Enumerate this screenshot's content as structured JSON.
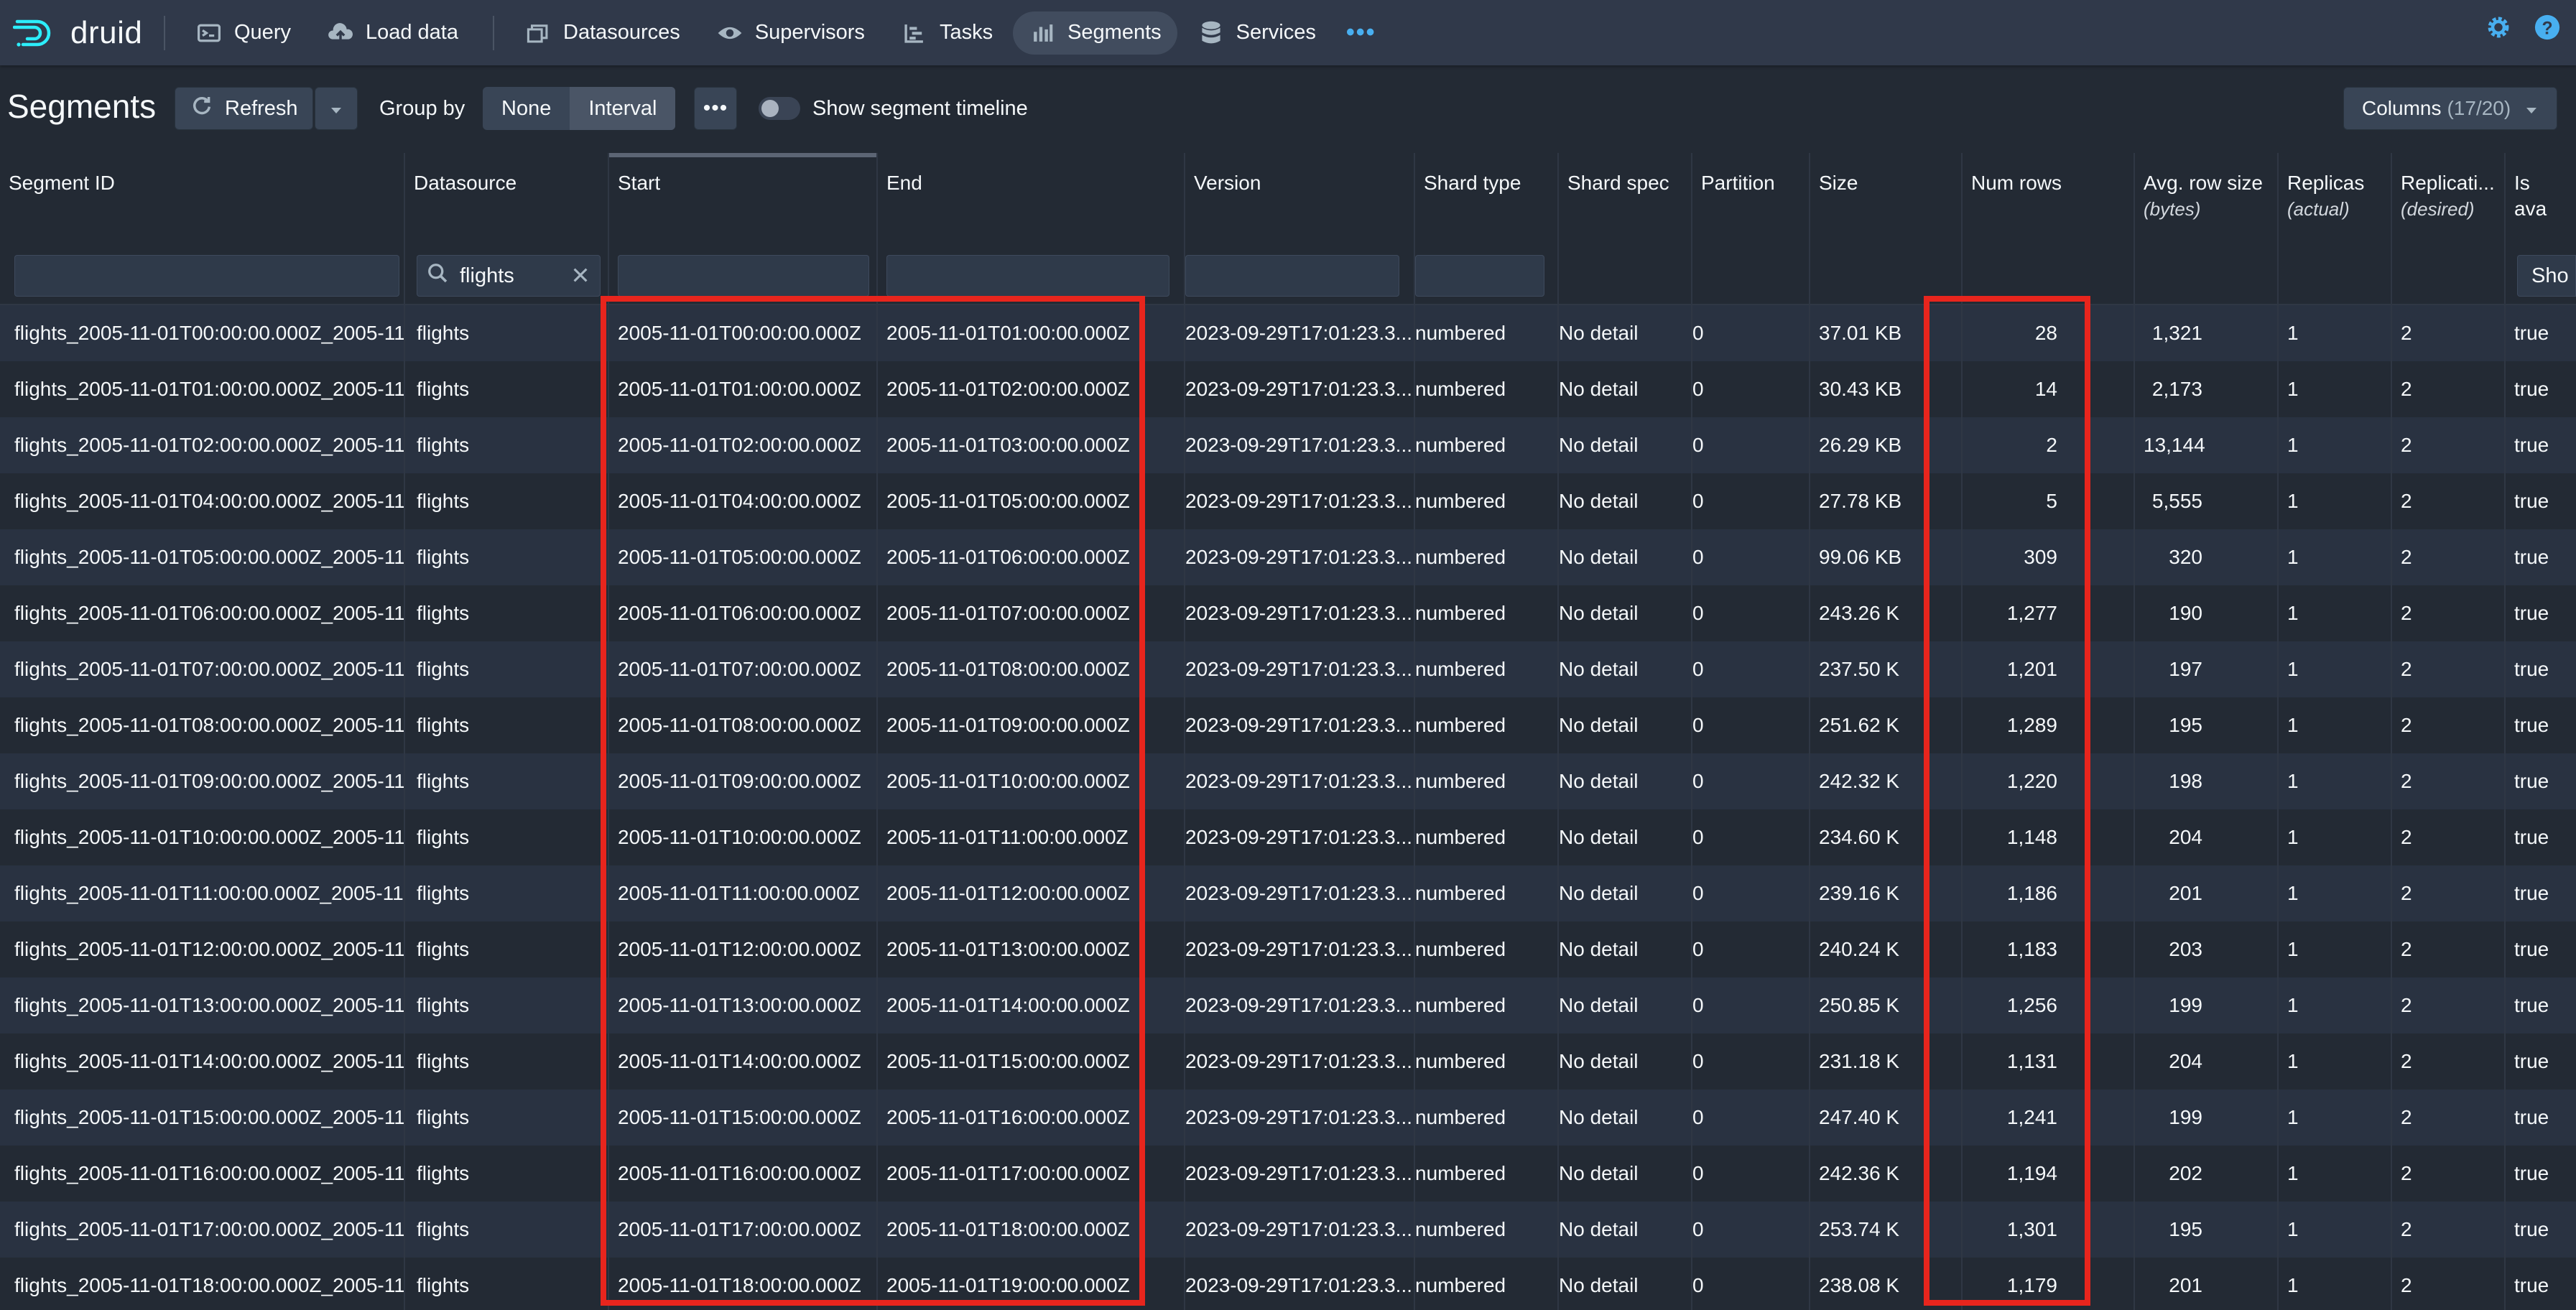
{
  "app": {
    "logo_text": "druid"
  },
  "nav": {
    "items": [
      {
        "label": "Query",
        "icon": "query-icon"
      },
      {
        "label": "Load data",
        "icon": "cloud-upload-icon"
      },
      {
        "label": "Datasources",
        "icon": "datasources-icon"
      },
      {
        "label": "Supervisors",
        "icon": "eye-icon"
      },
      {
        "label": "Tasks",
        "icon": "tasks-icon"
      },
      {
        "label": "Segments",
        "icon": "segments-icon",
        "active": true
      },
      {
        "label": "Services",
        "icon": "database-icon"
      }
    ],
    "more": "•••"
  },
  "controls": {
    "title": "Segments",
    "refresh_label": "Refresh",
    "group_by_label": "Group by",
    "group_none": "None",
    "group_interval": "Interval",
    "more_label": "•••",
    "timeline_label": "Show segment timeline",
    "timeline_on": false,
    "columns_label": "Columns",
    "columns_count": "(17/20)"
  },
  "table": {
    "headers": {
      "segment_id": "Segment ID",
      "datasource": "Datasource",
      "start": "Start",
      "end": "End",
      "version": "Version",
      "shard_type": "Shard type",
      "shard_spec": "Shard spec",
      "partition": "Partition",
      "size": "Size",
      "num_rows": "Num rows",
      "avg_row_size": "Avg. row size",
      "avg_row_size_sub": "(bytes)",
      "replicas": "Replicas",
      "replicas_sub": "(actual)",
      "replication": "Replicati...",
      "replication_sub": "(desired)",
      "is_available": "Is ava"
    },
    "filters": {
      "datasource_value": "flights",
      "is_available_value": "Sho"
    },
    "rows": [
      {
        "id": "flights_2005-11-01T00:00:00.000Z_2005-11...",
        "ds": "flights",
        "start": "2005-11-01T00:00:00.000Z",
        "end": "2005-11-01T01:00:00.000Z",
        "version": "2023-09-29T17:01:23.3...",
        "shard_type": "numbered",
        "shard_spec": "No detail",
        "partition": "0",
        "size": "37.01 KB",
        "num_rows": "28",
        "avg": "1,321",
        "replicas": "1",
        "replication": "2",
        "avail": "true"
      },
      {
        "id": "flights_2005-11-01T01:00:00.000Z_2005-11...",
        "ds": "flights",
        "start": "2005-11-01T01:00:00.000Z",
        "end": "2005-11-01T02:00:00.000Z",
        "version": "2023-09-29T17:01:23.3...",
        "shard_type": "numbered",
        "shard_spec": "No detail",
        "partition": "0",
        "size": "30.43 KB",
        "num_rows": "14",
        "avg": "2,173",
        "replicas": "1",
        "replication": "2",
        "avail": "true"
      },
      {
        "id": "flights_2005-11-01T02:00:00.000Z_2005-11...",
        "ds": "flights",
        "start": "2005-11-01T02:00:00.000Z",
        "end": "2005-11-01T03:00:00.000Z",
        "version": "2023-09-29T17:01:23.3...",
        "shard_type": "numbered",
        "shard_spec": "No detail",
        "partition": "0",
        "size": "26.29 KB",
        "num_rows": "2",
        "avg": "13,144",
        "replicas": "1",
        "replication": "2",
        "avail": "true"
      },
      {
        "id": "flights_2005-11-01T04:00:00.000Z_2005-11...",
        "ds": "flights",
        "start": "2005-11-01T04:00:00.000Z",
        "end": "2005-11-01T05:00:00.000Z",
        "version": "2023-09-29T17:01:23.3...",
        "shard_type": "numbered",
        "shard_spec": "No detail",
        "partition": "0",
        "size": "27.78 KB",
        "num_rows": "5",
        "avg": "5,555",
        "replicas": "1",
        "replication": "2",
        "avail": "true"
      },
      {
        "id": "flights_2005-11-01T05:00:00.000Z_2005-11...",
        "ds": "flights",
        "start": "2005-11-01T05:00:00.000Z",
        "end": "2005-11-01T06:00:00.000Z",
        "version": "2023-09-29T17:01:23.3...",
        "shard_type": "numbered",
        "shard_spec": "No detail",
        "partition": "0",
        "size": "99.06 KB",
        "num_rows": "309",
        "avg": "320",
        "replicas": "1",
        "replication": "2",
        "avail": "true"
      },
      {
        "id": "flights_2005-11-01T06:00:00.000Z_2005-11...",
        "ds": "flights",
        "start": "2005-11-01T06:00:00.000Z",
        "end": "2005-11-01T07:00:00.000Z",
        "version": "2023-09-29T17:01:23.3...",
        "shard_type": "numbered",
        "shard_spec": "No detail",
        "partition": "0",
        "size": "243.26 KB",
        "num_rows": "1,277",
        "avg": "190",
        "replicas": "1",
        "replication": "2",
        "avail": "true"
      },
      {
        "id": "flights_2005-11-01T07:00:00.000Z_2005-11...",
        "ds": "flights",
        "start": "2005-11-01T07:00:00.000Z",
        "end": "2005-11-01T08:00:00.000Z",
        "version": "2023-09-29T17:01:23.3...",
        "shard_type": "numbered",
        "shard_spec": "No detail",
        "partition": "0",
        "size": "237.50 KB",
        "num_rows": "1,201",
        "avg": "197",
        "replicas": "1",
        "replication": "2",
        "avail": "true"
      },
      {
        "id": "flights_2005-11-01T08:00:00.000Z_2005-11...",
        "ds": "flights",
        "start": "2005-11-01T08:00:00.000Z",
        "end": "2005-11-01T09:00:00.000Z",
        "version": "2023-09-29T17:01:23.3...",
        "shard_type": "numbered",
        "shard_spec": "No detail",
        "partition": "0",
        "size": "251.62 KB",
        "num_rows": "1,289",
        "avg": "195",
        "replicas": "1",
        "replication": "2",
        "avail": "true"
      },
      {
        "id": "flights_2005-11-01T09:00:00.000Z_2005-11...",
        "ds": "flights",
        "start": "2005-11-01T09:00:00.000Z",
        "end": "2005-11-01T10:00:00.000Z",
        "version": "2023-09-29T17:01:23.3...",
        "shard_type": "numbered",
        "shard_spec": "No detail",
        "partition": "0",
        "size": "242.32 KB",
        "num_rows": "1,220",
        "avg": "198",
        "replicas": "1",
        "replication": "2",
        "avail": "true"
      },
      {
        "id": "flights_2005-11-01T10:00:00.000Z_2005-11...",
        "ds": "flights",
        "start": "2005-11-01T10:00:00.000Z",
        "end": "2005-11-01T11:00:00.000Z",
        "version": "2023-09-29T17:01:23.3...",
        "shard_type": "numbered",
        "shard_spec": "No detail",
        "partition": "0",
        "size": "234.60 KB",
        "num_rows": "1,148",
        "avg": "204",
        "replicas": "1",
        "replication": "2",
        "avail": "true"
      },
      {
        "id": "flights_2005-11-01T11:00:00.000Z_2005-11...",
        "ds": "flights",
        "start": "2005-11-01T11:00:00.000Z",
        "end": "2005-11-01T12:00:00.000Z",
        "version": "2023-09-29T17:01:23.3...",
        "shard_type": "numbered",
        "shard_spec": "No detail",
        "partition": "0",
        "size": "239.16 KB",
        "num_rows": "1,186",
        "avg": "201",
        "replicas": "1",
        "replication": "2",
        "avail": "true"
      },
      {
        "id": "flights_2005-11-01T12:00:00.000Z_2005-11...",
        "ds": "flights",
        "start": "2005-11-01T12:00:00.000Z",
        "end": "2005-11-01T13:00:00.000Z",
        "version": "2023-09-29T17:01:23.3...",
        "shard_type": "numbered",
        "shard_spec": "No detail",
        "partition": "0",
        "size": "240.24 KB",
        "num_rows": "1,183",
        "avg": "203",
        "replicas": "1",
        "replication": "2",
        "avail": "true"
      },
      {
        "id": "flights_2005-11-01T13:00:00.000Z_2005-11...",
        "ds": "flights",
        "start": "2005-11-01T13:00:00.000Z",
        "end": "2005-11-01T14:00:00.000Z",
        "version": "2023-09-29T17:01:23.3...",
        "shard_type": "numbered",
        "shard_spec": "No detail",
        "partition": "0",
        "size": "250.85 KB",
        "num_rows": "1,256",
        "avg": "199",
        "replicas": "1",
        "replication": "2",
        "avail": "true"
      },
      {
        "id": "flights_2005-11-01T14:00:00.000Z_2005-11...",
        "ds": "flights",
        "start": "2005-11-01T14:00:00.000Z",
        "end": "2005-11-01T15:00:00.000Z",
        "version": "2023-09-29T17:01:23.3...",
        "shard_type": "numbered",
        "shard_spec": "No detail",
        "partition": "0",
        "size": "231.18 KB",
        "num_rows": "1,131",
        "avg": "204",
        "replicas": "1",
        "replication": "2",
        "avail": "true"
      },
      {
        "id": "flights_2005-11-01T15:00:00.000Z_2005-11...",
        "ds": "flights",
        "start": "2005-11-01T15:00:00.000Z",
        "end": "2005-11-01T16:00:00.000Z",
        "version": "2023-09-29T17:01:23.3...",
        "shard_type": "numbered",
        "shard_spec": "No detail",
        "partition": "0",
        "size": "247.40 KB",
        "num_rows": "1,241",
        "avg": "199",
        "replicas": "1",
        "replication": "2",
        "avail": "true"
      },
      {
        "id": "flights_2005-11-01T16:00:00.000Z_2005-11...",
        "ds": "flights",
        "start": "2005-11-01T16:00:00.000Z",
        "end": "2005-11-01T17:00:00.000Z",
        "version": "2023-09-29T17:01:23.3...",
        "shard_type": "numbered",
        "shard_spec": "No detail",
        "partition": "0",
        "size": "242.36 KB",
        "num_rows": "1,194",
        "avg": "202",
        "replicas": "1",
        "replication": "2",
        "avail": "true"
      },
      {
        "id": "flights_2005-11-01T17:00:00.000Z_2005-11...",
        "ds": "flights",
        "start": "2005-11-01T17:00:00.000Z",
        "end": "2005-11-01T18:00:00.000Z",
        "version": "2023-09-29T17:01:23.3...",
        "shard_type": "numbered",
        "shard_spec": "No detail",
        "partition": "0",
        "size": "253.74 KB",
        "num_rows": "1,301",
        "avg": "195",
        "replicas": "1",
        "replication": "2",
        "avail": "true"
      },
      {
        "id": "flights_2005-11-01T18:00:00.000Z_2005-11...",
        "ds": "flights",
        "start": "2005-11-01T18:00:00.000Z",
        "end": "2005-11-01T19:00:00.000Z",
        "version": "2023-09-29T17:01:23.3...",
        "shard_type": "numbered",
        "shard_spec": "No detail",
        "partition": "0",
        "size": "238.08 KB",
        "num_rows": "1,179",
        "avg": "201",
        "replicas": "1",
        "replication": "2",
        "avail": "true"
      }
    ]
  },
  "colors": {
    "highlight": "#e8251d",
    "accent": "#48aff0",
    "nav_bg": "#30394a",
    "page_bg": "#232a34"
  }
}
